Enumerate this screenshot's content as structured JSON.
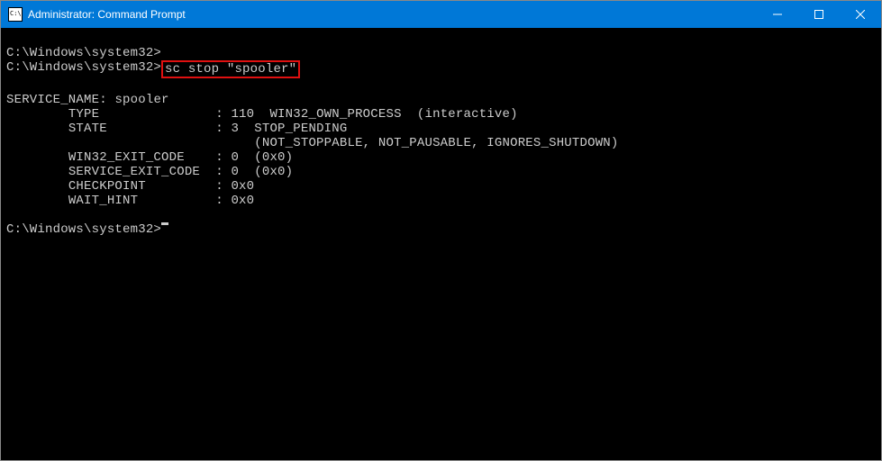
{
  "titlebar": {
    "title": "Administrator: Command Prompt"
  },
  "terminal": {
    "line1_prompt": "C:\\Windows\\system32>",
    "line2_prompt": "C:\\Windows\\system32>",
    "line2_command": "sc stop \"spooler\"",
    "output": {
      "service_name_label": "SERVICE_NAME:",
      "service_name_value": "spooler",
      "type_label": "TYPE",
      "type_value": "110  WIN32_OWN_PROCESS  (interactive)",
      "state_label": "STATE",
      "state_value": "3  STOP_PENDING",
      "state_flags": "(NOT_STOPPABLE, NOT_PAUSABLE, IGNORES_SHUTDOWN)",
      "win32_exit_label": "WIN32_EXIT_CODE",
      "win32_exit_value": "0  (0x0)",
      "service_exit_label": "SERVICE_EXIT_CODE",
      "service_exit_value": "0  (0x0)",
      "checkpoint_label": "CHECKPOINT",
      "checkpoint_value": "0x0",
      "wait_hint_label": "WAIT_HINT",
      "wait_hint_value": "0x0"
    },
    "line_end_prompt": "C:\\Windows\\system32>"
  }
}
